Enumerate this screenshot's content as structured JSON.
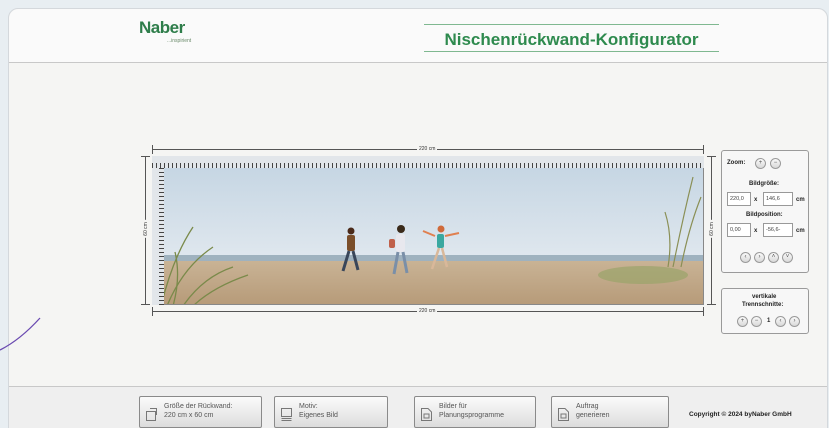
{
  "header": {
    "logo_text": "Naber",
    "logo_tagline": "...inspirient",
    "title": "Nischenrückwand-Konfigurator"
  },
  "canvas": {
    "width_label_top": "220 cm",
    "width_label_bottom": "220 cm",
    "height_label_left": "60 cm",
    "height_label_right": "60 cm"
  },
  "zoom_panel": {
    "zoom_label": "Zoom:",
    "zoom_in": "+",
    "zoom_out": "−",
    "bildgroesse_label": "Bildgröße:",
    "size_width": "220,0",
    "size_height": "146,6",
    "size_x": "x",
    "size_unit": "cm",
    "bildposition_label": "Bildposition:",
    "pos_x": "0,00",
    "pos_y": "-56,6-",
    "pos_x_sep": "x",
    "pos_unit": "cm",
    "arrows": [
      "‹",
      "›",
      "˄",
      "˅"
    ]
  },
  "separator_panel": {
    "label_line1": "vertikale",
    "label_line2": "Trennschnitte:",
    "btn_add": "+",
    "btn_remove": "−",
    "count": "1",
    "btn_prev": "‹",
    "btn_next": "›"
  },
  "footer": {
    "buttons": [
      {
        "line1": "Größe der Rückwand:",
        "line2": "220 cm x 60 cm",
        "icon": "resize-icon"
      },
      {
        "line1": "Motiv:",
        "line2": "Eigenes Bild",
        "icon": "image-icon"
      },
      {
        "line1": "Bilder für",
        "line2": "Planungsprogramme",
        "icon": "document-icon"
      },
      {
        "line1": "Auftrag",
        "line2": "generieren",
        "icon": "document-icon"
      }
    ],
    "copyright": "Copyright © 2024 byNaber GmbH"
  },
  "colors": {
    "brand_green": "#2e8a4e",
    "panel_border": "#9a9a9a"
  }
}
